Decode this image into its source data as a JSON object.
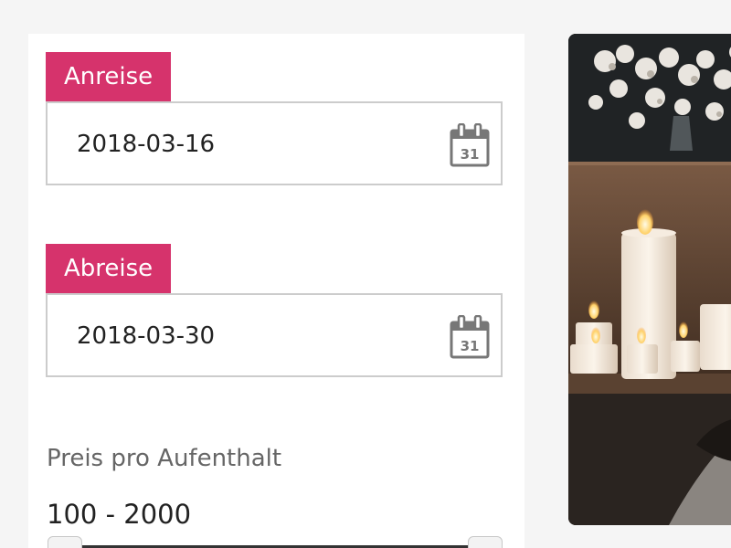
{
  "form": {
    "arrival": {
      "label": "Anreise",
      "value": "2018-03-16",
      "icon": "calendar-icon",
      "icon_number": "31"
    },
    "departure": {
      "label": "Abreise",
      "value": "2018-03-30",
      "icon": "calendar-icon",
      "icon_number": "31"
    },
    "price": {
      "label": "Preis pro Aufenthalt",
      "range_text": "100 - 2000",
      "min": 100,
      "max": 2000
    }
  },
  "colors": {
    "label_background": "#d6336c",
    "border": "#cccccc",
    "icon": "#777777"
  }
}
